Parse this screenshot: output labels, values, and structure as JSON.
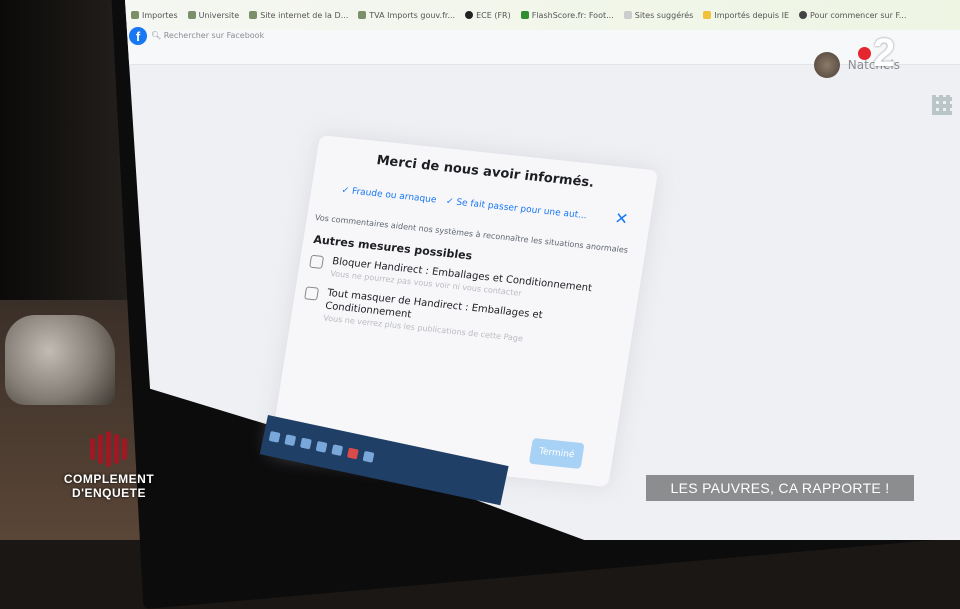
{
  "browser": {
    "bookmarks": [
      {
        "label": "Importes",
        "icon": "bookmark-icon"
      },
      {
        "label": "Universite",
        "icon": "bookmark-icon"
      },
      {
        "label": "Site internet de la D...",
        "icon": "bookmark-icon"
      },
      {
        "label": "TVA Imports gouv.fr...",
        "icon": "bookmark-icon"
      },
      {
        "label": "ECE (FR)",
        "icon": "github-icon"
      },
      {
        "label": "FlashScore.fr: Foot...",
        "icon": "flashscore-icon"
      },
      {
        "label": "Sites suggérés",
        "icon": "page-icon"
      },
      {
        "label": "Importés depuis IE",
        "icon": "folder-icon"
      },
      {
        "label": "Pour commencer sur F...",
        "icon": "globe-icon"
      }
    ]
  },
  "facebook": {
    "search_placeholder": "Rechercher sur Facebook",
    "profile_name": "Natcheis"
  },
  "dialog": {
    "title": "Merci de nous avoir informés.",
    "chips": [
      "Fraude ou arnaque",
      "Se fait passer pour une aut..."
    ],
    "help_text": "Vos commentaires aident nos systèmes à reconnaître les situations anormales",
    "section_title": "Autres mesures possibles",
    "options": [
      {
        "title": "Bloquer Handirect : Emballages et Conditionnement",
        "subtitle": "Vous ne pourrez pas vous voir ni vous contacter",
        "icon": "block-user-icon"
      },
      {
        "title": "Tout masquer de Handirect : Emballages et Conditionnement",
        "subtitle": "Vous ne verrez plus les publications de cette Page",
        "icon": "hide-icon"
      }
    ],
    "done_label": "Terminé"
  },
  "broadcast": {
    "channel_logo": "2",
    "show_name_line1": "COMPLEMENT",
    "show_name_line2": "D'ENQUETE",
    "lower_third": "LES PAUVRES, CA RAPPORTE !",
    "accent_color": "#e3262f",
    "emblem_color": "#a11723"
  }
}
